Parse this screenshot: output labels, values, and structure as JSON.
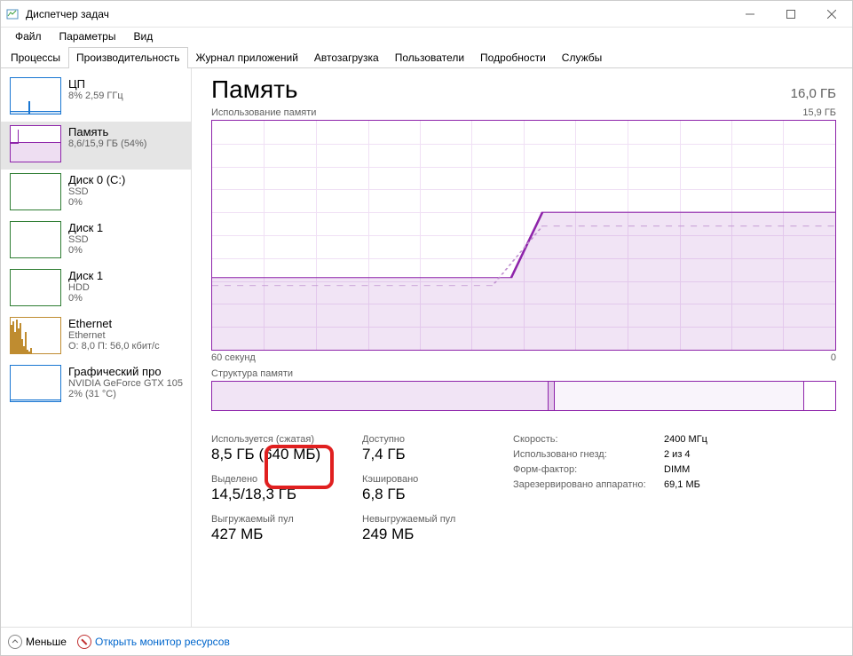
{
  "window": {
    "title": "Диспетчер задач"
  },
  "menu": {
    "file": "Файл",
    "options": "Параметры",
    "view": "Вид"
  },
  "tabs": {
    "processes": "Процессы",
    "performance": "Производительность",
    "app_history": "Журнал приложений",
    "startup": "Автозагрузка",
    "users": "Пользователи",
    "details": "Подробности",
    "services": "Службы"
  },
  "sidebar": {
    "cpu": {
      "title": "ЦП",
      "sub": "8% 2,59 ГГц"
    },
    "memory": {
      "title": "Память",
      "sub": "8,6/15,9 ГБ (54%)"
    },
    "disk0": {
      "title": "Диск 0 (C:)",
      "sub1": "SSD",
      "sub2": "0%"
    },
    "disk1": {
      "title": "Диск 1",
      "sub1": "SSD",
      "sub2": "0%"
    },
    "disk1hdd": {
      "title": "Диск 1",
      "sub1": "HDD",
      "sub2": "0%"
    },
    "ethernet": {
      "title": "Ethernet",
      "sub1": "Ethernet",
      "sub2": "О: 8,0 П: 56,0 кбит/с"
    },
    "gpu": {
      "title": "Графический про",
      "sub1": "NVIDIA GeForce GTX 105",
      "sub2": "2% (31 °C)"
    }
  },
  "main": {
    "title": "Память",
    "total": "16,0 ГБ",
    "chart_label": "Использование памяти",
    "chart_max": "15,9 ГБ",
    "chart_xlabel": "60 секунд",
    "chart_xright": "0",
    "composition_label": "Структура памяти",
    "stats": {
      "in_use_label": "Используется (сжатая)",
      "in_use_value": "8,5 ГБ (640 МБ)",
      "available_label": "Доступно",
      "available_value": "7,4 ГБ",
      "committed_label": "Выделено",
      "committed_value": "14,5/18,3 ГБ",
      "cached_label": "Кэшировано",
      "cached_value": "6,8 ГБ",
      "paged_label": "Выгружаемый пул",
      "paged_value": "427 МБ",
      "nonpaged_label": "Невыгружаемый пул",
      "nonpaged_value": "249 МБ"
    },
    "specs": {
      "speed_label": "Скорость:",
      "speed_value": "2400 МГц",
      "slots_label": "Использовано гнезд:",
      "slots_value": "2 из 4",
      "form_label": "Форм-фактор:",
      "form_value": "DIMM",
      "reserved_label": "Зарезервировано аппаратно:",
      "reserved_value": "69,1 МБ"
    }
  },
  "chart_data": {
    "type": "area",
    "title": "Использование памяти",
    "ylabel": "ГБ",
    "ylim": [
      0,
      15.9
    ],
    "xlim_label": [
      "60 секунд",
      "0"
    ],
    "series": [
      {
        "name": "Использование памяти",
        "values_approx": "примерно 5 ГБ до отметки ~50%, затем скачок до ~8.6 ГБ и плато",
        "x_fraction_points": [
          0,
          0.49,
          0.52,
          1.0
        ],
        "y_values": [
          5.0,
          5.0,
          8.6,
          8.6
        ]
      }
    ]
  },
  "bottom": {
    "less": "Меньше",
    "open_monitor": "Открыть монитор ресурсов"
  }
}
